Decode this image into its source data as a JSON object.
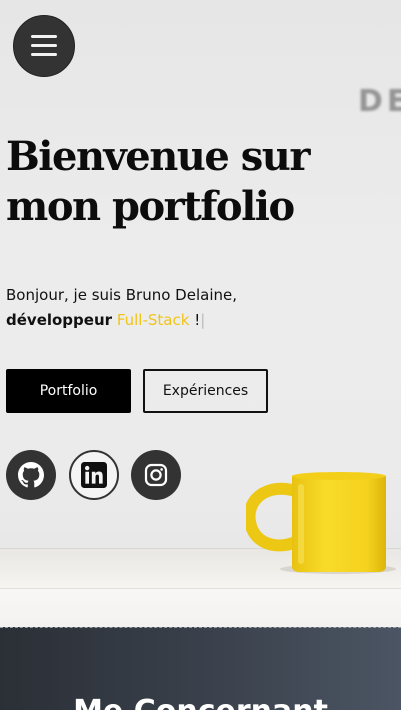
{
  "hero": {
    "background_text": "DE",
    "title_line1": "Bienvenue sur",
    "title_line2": "mon portfolio",
    "intro_line1": "Bonjour, je suis Bruno Delaine,",
    "role_word": "développeur",
    "typed_text": "Full-Stack",
    "exclamation": "!",
    "cursor": "|"
  },
  "nav": {
    "menu_icon": "hamburger-menu-icon"
  },
  "buttons": {
    "portfolio_label": "Portfolio",
    "experiences_label": "Expériences"
  },
  "social": [
    {
      "name": "GitHub",
      "icon": "github-icon"
    },
    {
      "name": "LinkedIn",
      "icon": "linkedin-icon"
    },
    {
      "name": "Instagram",
      "icon": "instagram-icon"
    }
  ],
  "about": {
    "title": "Me Concernant"
  },
  "colors": {
    "accent": "#f0c419",
    "dark": "#333333",
    "mug": "#f5d21e"
  }
}
